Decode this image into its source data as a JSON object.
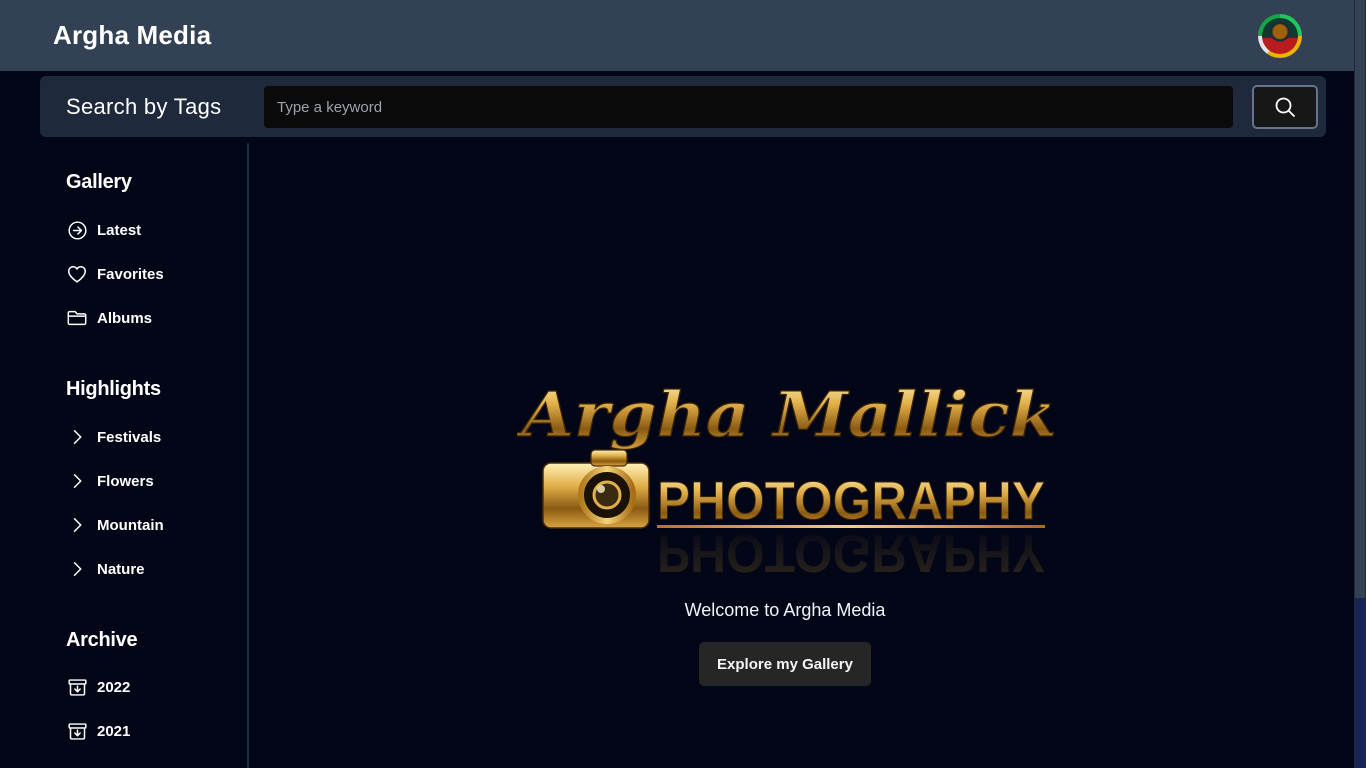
{
  "header": {
    "brand": "Argha Media",
    "avatar_icon": "user-avatar"
  },
  "search": {
    "title": "Search by Tags",
    "placeholder": "Type a keyword",
    "value": "",
    "button_icon": "search-icon"
  },
  "sidebar": {
    "gallery": {
      "title": "Gallery",
      "items": [
        {
          "label": "Latest",
          "icon": "arrow-circle-right-icon"
        },
        {
          "label": "Favorites",
          "icon": "heart-icon"
        },
        {
          "label": "Albums",
          "icon": "folder-icon"
        }
      ]
    },
    "highlights": {
      "title": "Highlights",
      "items": [
        {
          "label": "Festivals",
          "icon": "chevron-right-icon"
        },
        {
          "label": "Flowers",
          "icon": "chevron-right-icon"
        },
        {
          "label": "Mountain",
          "icon": "chevron-right-icon"
        },
        {
          "label": "Nature",
          "icon": "chevron-right-icon"
        }
      ]
    },
    "archive": {
      "title": "Archive",
      "items": [
        {
          "label": "2022",
          "icon": "archive-box-icon"
        },
        {
          "label": "2021",
          "icon": "archive-box-icon"
        }
      ]
    }
  },
  "main": {
    "logo": {
      "script_text": "Argha Mallick",
      "word_text": "PHOTOGRAPHY"
    },
    "welcome": "Welcome to Argha Media",
    "explore_label": "Explore my Gallery"
  },
  "colors": {
    "background": "#020617",
    "topbar": "#334155",
    "searchbar": "#1e293b",
    "gold": "#c9962a"
  }
}
